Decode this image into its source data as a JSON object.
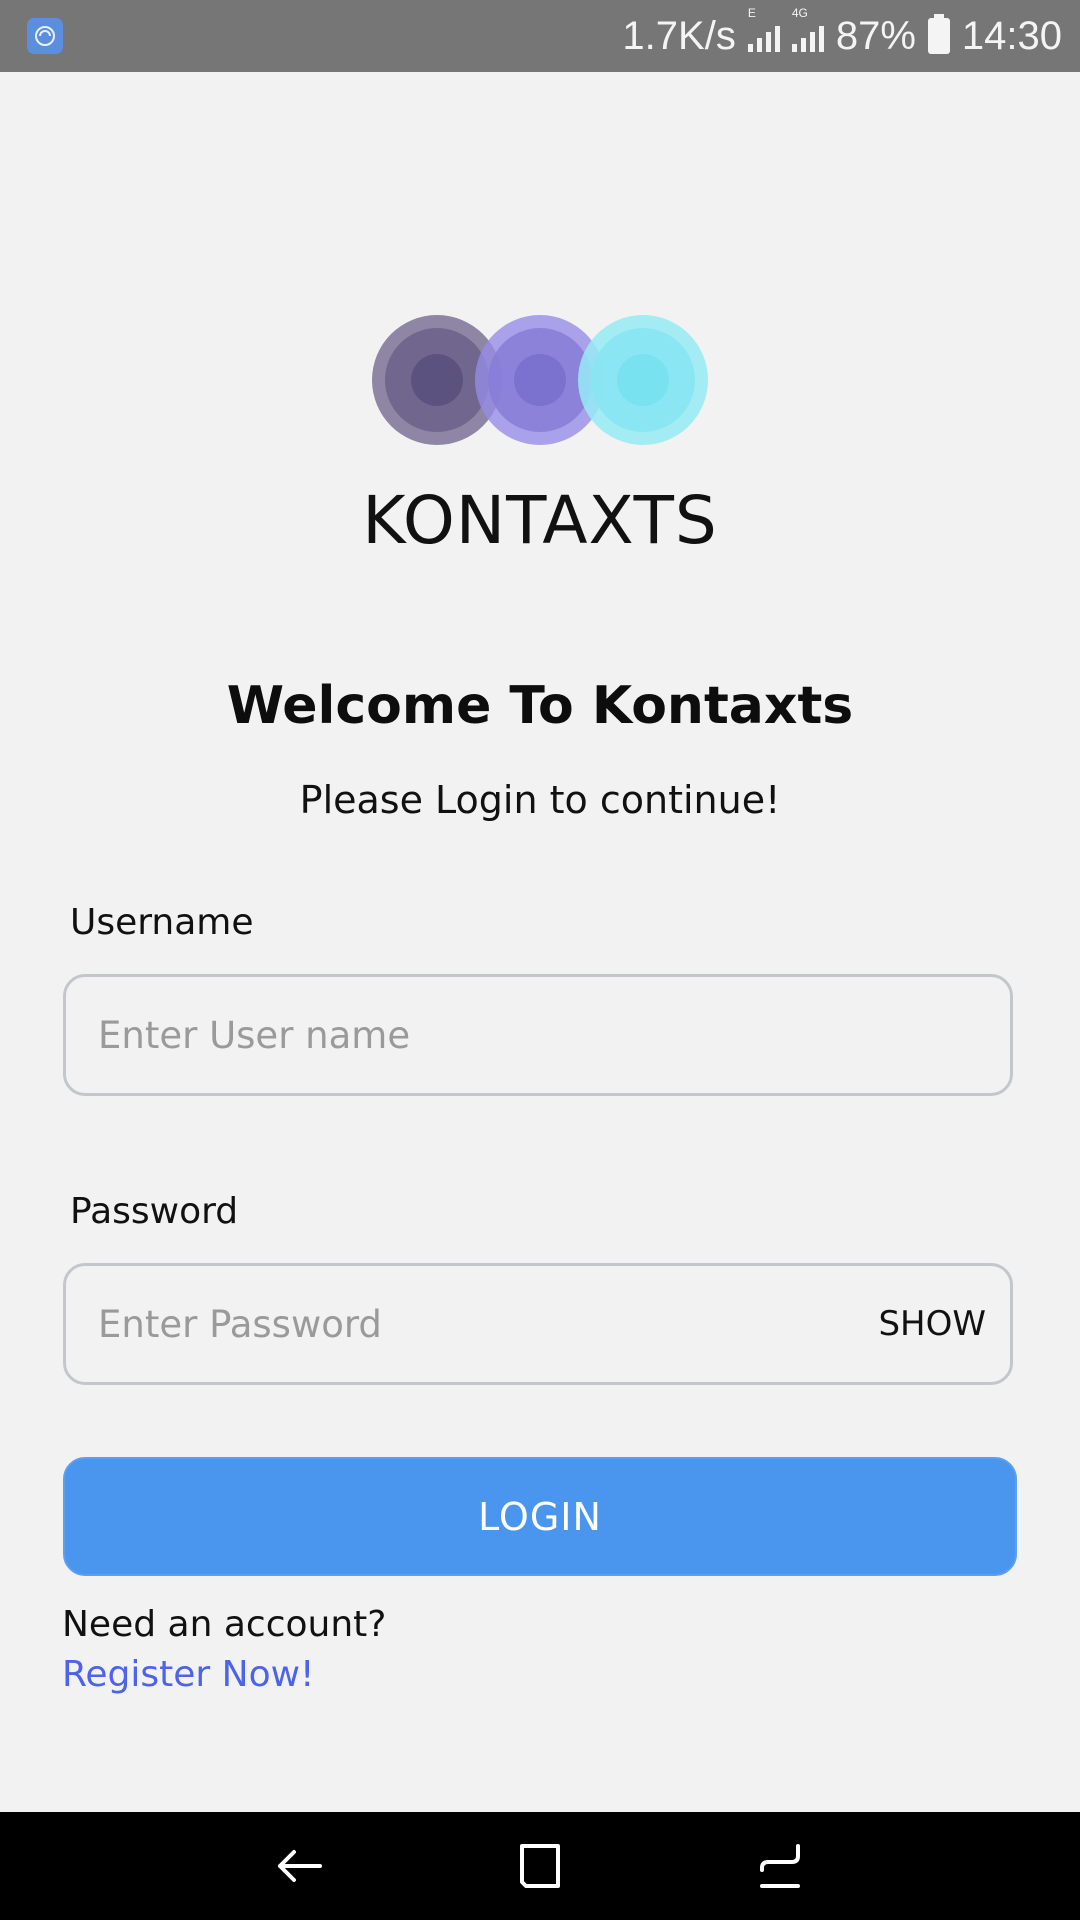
{
  "status_bar": {
    "speed": "1.7K/s",
    "signal1_tag": "E",
    "signal2_tag": "4G",
    "battery": "87%",
    "time": "14:30"
  },
  "logo": {
    "brand": "KONTAXTS",
    "colors": [
      "#7d7396",
      "#968ce6",
      "#96ebf5"
    ]
  },
  "heading": {
    "welcome": "Welcome To Kontaxts",
    "subtitle": "Please Login to continue!"
  },
  "form": {
    "username_label": "Username",
    "username_placeholder": "Enter User name",
    "username_value": "",
    "password_label": "Password",
    "password_placeholder": "Enter Password",
    "password_value": "",
    "show_label": "SHOW",
    "login_label": "LOGIN"
  },
  "footer": {
    "account_prompt": "Need an account?",
    "register_link": "Register Now!"
  },
  "nav": {
    "icons": [
      "back-icon",
      "home-icon",
      "recent-apps-icon"
    ]
  },
  "colors": {
    "primary": "#4a95ed",
    "link": "#4d64e8",
    "background": "#f2f2f2"
  }
}
